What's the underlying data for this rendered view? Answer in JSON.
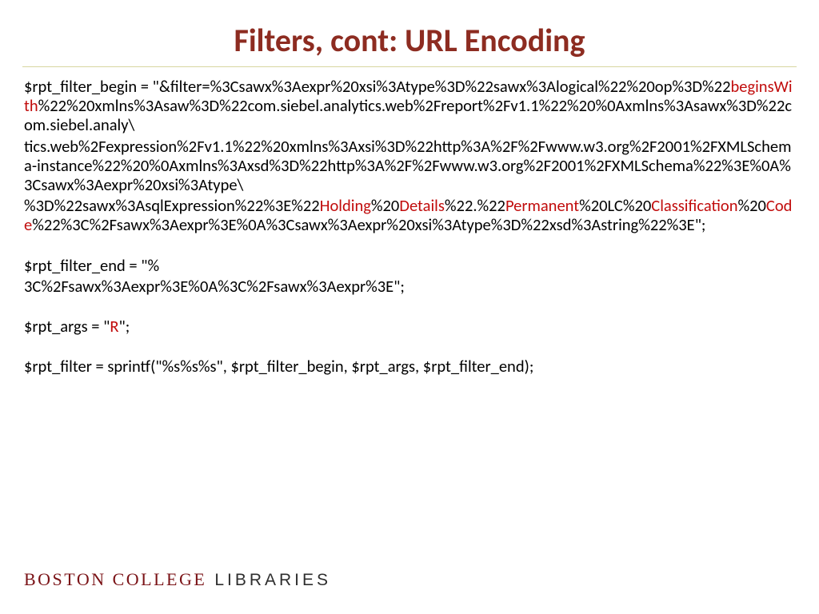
{
  "title": "Filters, cont: URL Encoding",
  "code": {
    "p1a": "$rpt_filter_begin = \"&filter=%3Csawx%3Aexpr%20xsi%3Atype%3D%22sawx%3Alogical%22%20op%3D%22",
    "p1_hl1": "beginsWith",
    "p1b": "%22%20xmlns%3Asaw%3D%22com.siebel.analytics.web%2Freport%2Fv1.1%22%20%0Axmlns%3Asawx%3D%22com.siebel.analy\\",
    "p2": "tics.web%2Fexpression%2Fv1.1%22%20xmlns%3Axsi%3D%22http%3A%2F%2Fwww.w3.org%2F2001%2FXMLSchema-instance%22%20%0Axmlns%3Axsd%3D%22http%3A%2F%2Fwww.w3.org%2F2001%2FXMLSchema%22%3E%0A%3Csawx%3Aexpr%20xsi%3Atype\\",
    "p3a": "%3D%22sawx%3AsqlExpression%22%3E%22",
    "p3_hl1": "Holding",
    "p3b": "%20",
    "p3_hl2": "Details",
    "p3c": "%22.%22",
    "p3_hl3": "Permanent",
    "p3d": "%20LC%20",
    "p3_hl4": "Classification",
    "p3e": "%20",
    "p3_hl5": "Code",
    "p3f": "%22%3C%2Fsawx%3Aexpr%3E%0A%3Csawx%3Aexpr%20xsi%3Atype%3D%22xsd%3Astring%22%3E",
    "p3g": "\";",
    "p4": "$rpt_filter_end = \"%",
    "p5": "3C%2Fsawx%3Aexpr%3E%0A%3C%2Fsawx%3Aexpr%3E\";",
    "p6a": "$rpt_args = \"",
    "p6_hl": "R",
    "p6b": "\";",
    "p7": "$rpt_filter = sprintf(\"%s%s%s\", $rpt_filter_begin, $rpt_args, $rpt_filter_end);"
  },
  "footer": {
    "bc": "BOSTON COLLEGE",
    "lib": "LIBRARIES"
  }
}
